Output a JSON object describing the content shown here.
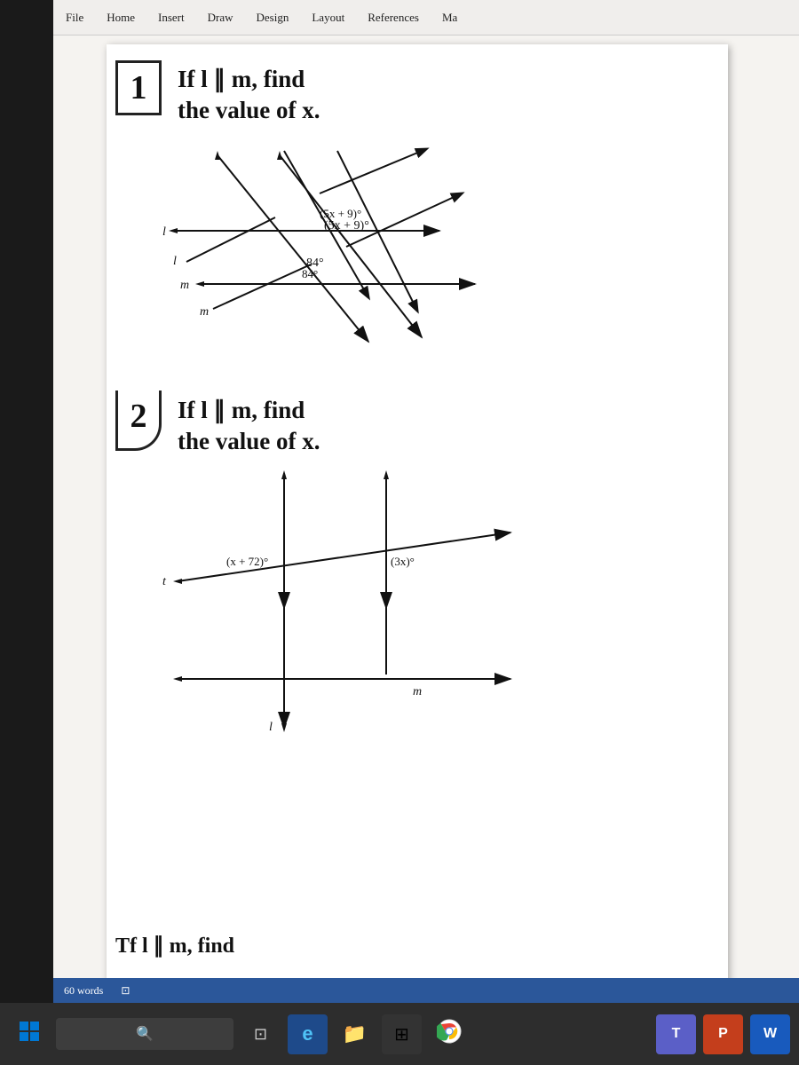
{
  "menubar": {
    "items": [
      "File",
      "Home",
      "Insert",
      "Draw",
      "Design",
      "Layout",
      "References",
      "Ma"
    ]
  },
  "problem1": {
    "number": "1",
    "text_line1": "If l ∥ m, find",
    "text_line2": "the value of x.",
    "angle1_label": "(5x + 9)°",
    "angle2_label": "84°",
    "line_l": "l",
    "line_m": "m"
  },
  "problem2": {
    "number": "2",
    "text_line1": "If l ∥ m, find",
    "text_line2": "the value of x.",
    "angle1_label": "(x + 72)°",
    "angle2_label": "(3x)°",
    "line_t": "t",
    "line_m": "m"
  },
  "problem3": {
    "partial_text": "Tf l ∥ m, find"
  },
  "statusbar": {
    "words": "60 words"
  },
  "taskbar": {
    "start_icon": "⊞",
    "search_icon": "🔍",
    "taskview_icon": "⊡",
    "edge_icon": "e",
    "explorer_icon": "📁",
    "chrome_icon": "●",
    "teams_icon": "T",
    "powerpoint_icon": "P",
    "word_icon": "W"
  }
}
